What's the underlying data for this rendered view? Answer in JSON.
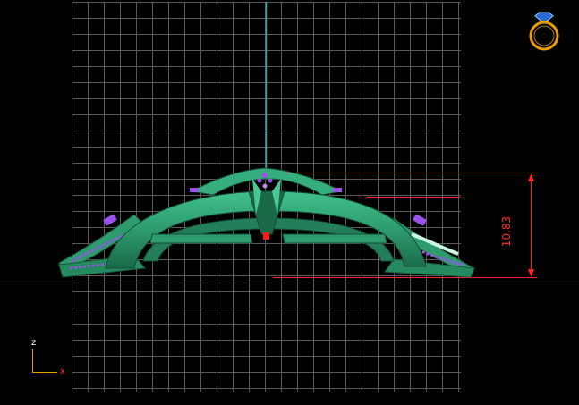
{
  "viewport": {
    "background": "#000000",
    "grid_color": "#5a5a5a",
    "horizon_color": "#c8c8c8",
    "center_axis_color": "#2aa8b8"
  },
  "model": {
    "body_color": "#2e9b6e",
    "highlight_color": "#8ff0c8",
    "stone_color": "#9a52e8",
    "marker_color": "#ff1a1a"
  },
  "dimension": {
    "value": "10.83",
    "color": "#ff2020"
  },
  "axes": {
    "z_label": "z",
    "x_label": "x",
    "z_color": "#ffffff",
    "x_color": "#ff3030"
  },
  "view_cube": {
    "icon": "ring-icon",
    "metal_color": "#e8a000",
    "gem_color": "#2a6ad8"
  }
}
